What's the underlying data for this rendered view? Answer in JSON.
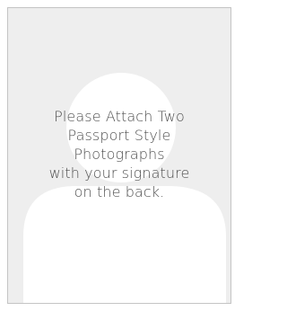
{
  "photo_placeholder": {
    "instruction_lines": [
      "Please Attach Two",
      "Passport Style",
      "Photographs",
      "with your signature",
      "on the back."
    ],
    "colors": {
      "frame_background": "#eeeeee",
      "frame_border": "#c4c4c4",
      "silhouette": "#ffffff",
      "text": "#4f4f4f"
    },
    "silhouette_icon": "person-silhouette-icon"
  }
}
